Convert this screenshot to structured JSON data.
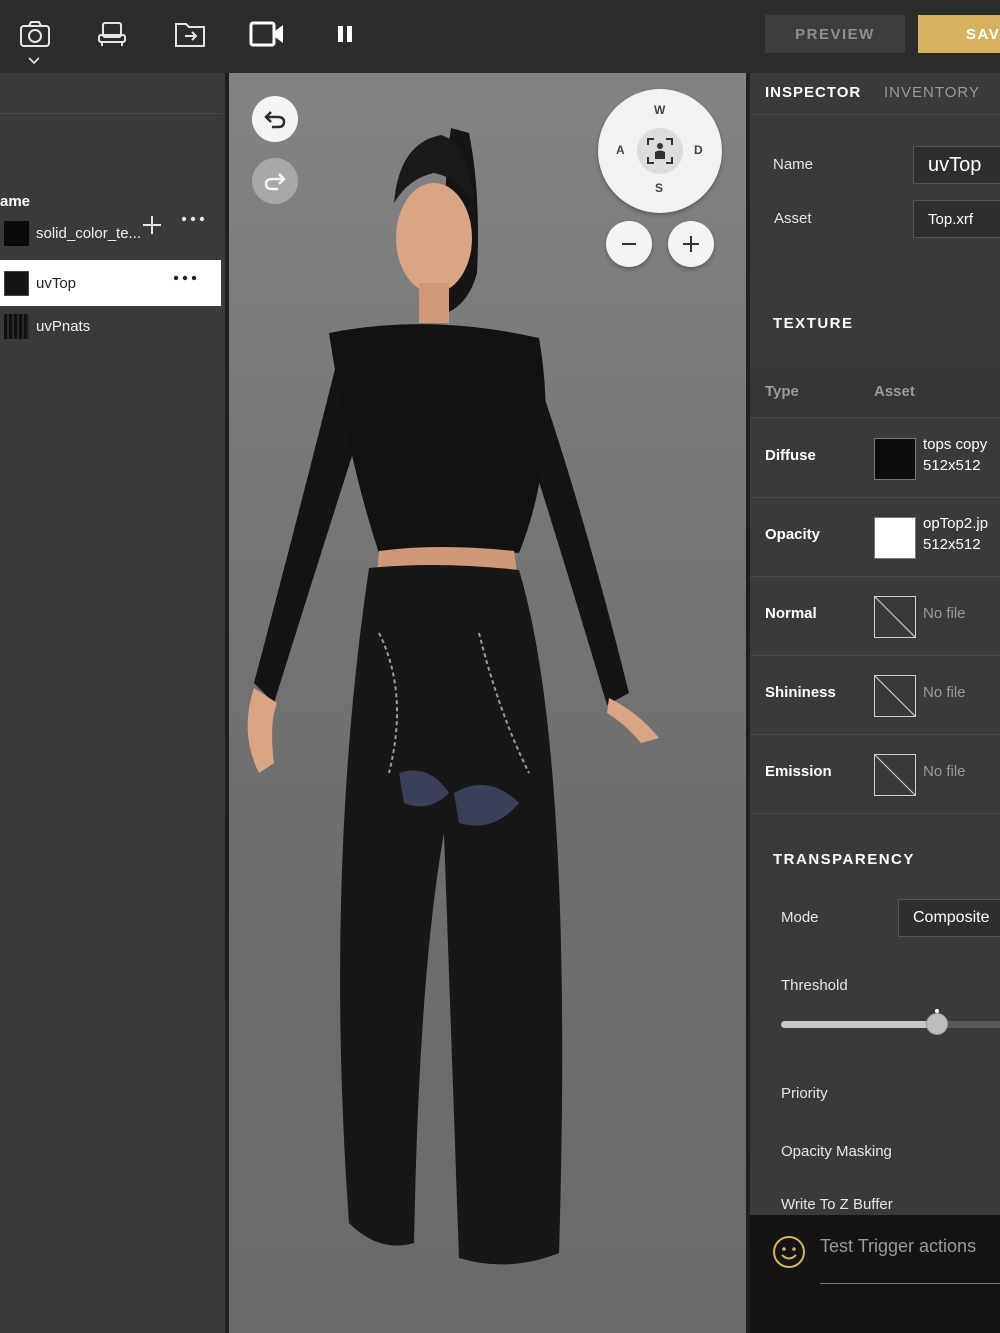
{
  "toolbar": {
    "icons": [
      "camera-icon",
      "furniture-icon",
      "folder-import-icon",
      "video-camera-icon",
      "pause-icon"
    ],
    "preview_label": "PREVIEW",
    "save_label": "SAV",
    "accent_color": "#d6b25e"
  },
  "left_panel": {
    "column_header": "ame",
    "items": [
      {
        "label": "solid_color_te..."
      },
      {
        "label": "uvTop",
        "selected": true
      },
      {
        "label": "uvPnats"
      }
    ]
  },
  "viewport": {
    "compass": {
      "north": "W",
      "west": "A",
      "east": "D",
      "south": "S"
    }
  },
  "inspector": {
    "tabs": [
      "INSPECTOR",
      "INVENTORY"
    ],
    "active_tab": "INSPECTOR",
    "name_label": "Name",
    "name_value": "uvTop",
    "asset_label": "Asset",
    "asset_value": "Top.xrf",
    "texture_title": "TEXTURE",
    "texture_col_type": "Type",
    "texture_col_asset": "Asset",
    "textures": [
      {
        "type": "Diffuse",
        "file": "tops copy",
        "size": "512x512"
      },
      {
        "type": "Opacity",
        "file": "opTop2.jp",
        "size": "512x512"
      },
      {
        "type": "Normal",
        "file": "No file"
      },
      {
        "type": "Shininess",
        "file": "No file"
      },
      {
        "type": "Emission",
        "file": "No file"
      }
    ],
    "transparency_title": "TRANSPARENCY",
    "mode_label": "Mode",
    "mode_value": "Composite",
    "threshold_label": "Threshold",
    "threshold_value": 0.68,
    "priority_label": "Priority",
    "opacity_masking_label": "Opacity Masking",
    "write_z_label": "Write To Z Buffer"
  },
  "chat": {
    "placeholder": "Test Trigger actions"
  }
}
